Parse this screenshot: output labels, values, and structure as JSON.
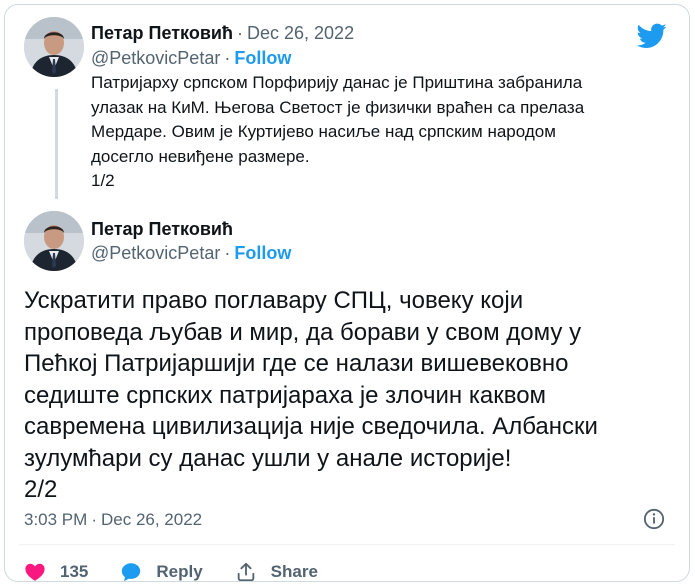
{
  "tweet1": {
    "author_name": "Петар Петковић",
    "date": "Dec 26, 2022",
    "handle": "@PetkovicPetar",
    "follow_label": "Follow",
    "text": "Патријарху српском Порфирију данас је  Приштина забранила\nулазак на КиМ. Његова Светост је физички враћен са прелаза\nМердаре. Овим је Куртијево насиље над српским народом\nдосегло невиђене размере.\n1/2"
  },
  "tweet2": {
    "author_name": "Петар Петковић",
    "handle": "@PetkovicPetar",
    "follow_label": "Follow",
    "text": "Ускратити право поглавару СПЦ, човеку који\nпроповеда љубав и мир, да борави у свом дому у\nПећкој Патријаршији где се налази вишевековно\nседиште српских патријараха је злочин каквом\nсавремена цивилизација није сведочила. Албански\nзулумћари су данас ушли у анале историје!\n2/2",
    "time": "3:03 PM",
    "date": "Dec 26, 2022",
    "like_count": "135",
    "reply_label": "Reply",
    "share_label": "Share"
  },
  "separator": "·",
  "icons": {
    "logo": "twitter-bird-icon",
    "info": "info-icon",
    "like": "heart-icon",
    "reply": "reply-bubble-icon",
    "share": "share-icon"
  },
  "colors": {
    "accent": "#1d9bf0",
    "like": "#f91880",
    "text": "#0f1419",
    "secondary": "#536471",
    "border": "#cfd9de"
  }
}
